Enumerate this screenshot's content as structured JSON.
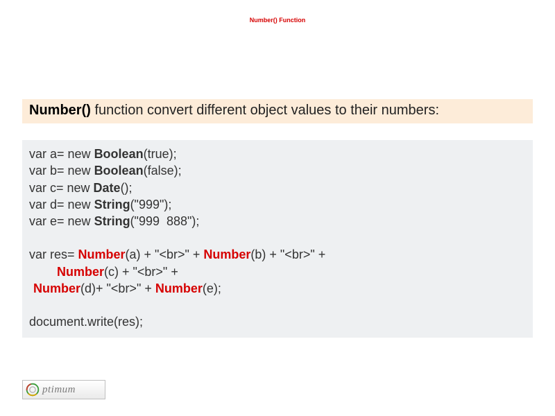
{
  "title": "Number() Function",
  "description": {
    "fn_name": "Number()",
    "rest": " function convert different object values to their numbers:"
  },
  "code": {
    "l1_pre": "var a= new ",
    "l1_type": "Boolean",
    "l1_post": "(true);",
    "l2_pre": "var b= new ",
    "l2_type": "Boolean",
    "l2_post": "(false);",
    "l3_pre": "var c= new ",
    "l3_type": "Date",
    "l3_post": "();",
    "l4_pre": "var d= new ",
    "l4_type": "String",
    "l4_post": "(\"999\");",
    "l5_pre": "var e= new ",
    "l5_type": "String",
    "l5_post": "(\"999  888\");",
    "l7_pre": "var res= ",
    "l7_n1": "Number",
    "l7_mid1": "(a) + \"<br>\" + ",
    "l7_n2": "Number",
    "l7_mid2": "(b) + \"<br>\" + ",
    "l8_n3": "Number",
    "l8_mid3": "(c) + \"<br>\" + ",
    "l9_n4": "Number",
    "l9_mid4": "(d)+ \"<br>\" + ",
    "l9_n5": "Number",
    "l9_post": "(e);",
    "l11": "document.write(res);"
  },
  "logo": {
    "text": "ptimum"
  }
}
